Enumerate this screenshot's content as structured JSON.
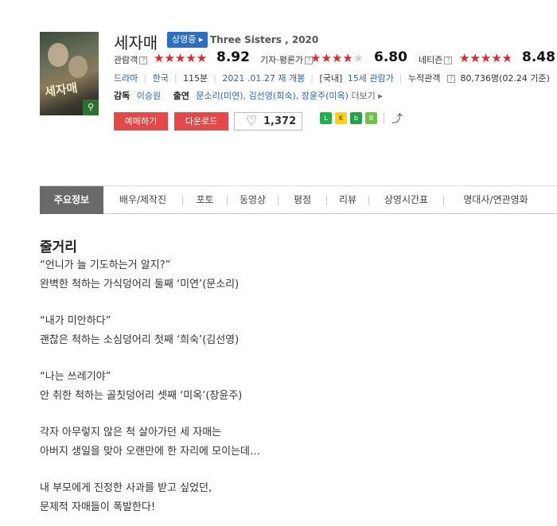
{
  "movie": {
    "title": "세자매",
    "status_badge": "상영중 ▸",
    "english_title": "Three Sisters , 2020"
  },
  "ratings": [
    {
      "label": "관람객",
      "help": "?",
      "score": "8.92",
      "value": 8.92
    },
    {
      "label": "기자·평론가",
      "help": "?",
      "score": "6.80",
      "value": 6.8
    },
    {
      "label": "네티즌",
      "help": "?",
      "score": "8.48",
      "value": 8.48
    }
  ],
  "meta": {
    "genre": "드라마",
    "country": "한국",
    "runtime": "115분",
    "release": "2021 .01.27 재 개봉",
    "rating_prefix": "[국내]",
    "rating": "15세 관람가",
    "audience_label": "누적관객",
    "audience_help": "?",
    "audience": "80,736명(02.24 기준)"
  },
  "crew": {
    "director_label": "감독",
    "director": "이승원",
    "cast_label": "출연",
    "cast": [
      "문소리(미연)",
      "김선영(희숙)",
      "장윤주(미옥)"
    ],
    "more": "더보기 ▸"
  },
  "actions": {
    "reserve": "예매하기",
    "download": "다운로드",
    "like_count": "1,372"
  },
  "share": {
    "icons": [
      "line-icon",
      "kakaotalk-icon",
      "band-icon",
      "naver-blog-icon"
    ],
    "share_icon": "share-icon"
  },
  "tabs": [
    "주요정보",
    "배우/제작진",
    "포토",
    "동영상",
    "평점",
    "리뷰",
    "상영시간표",
    "명대사/연관영화"
  ],
  "synopsis": {
    "heading": "줄거리",
    "lines": [
      "“언니가 늘 기도하는거 알지?”",
      " 완벽한 척하는 가식덩어리 둘째 ‘미연’(문소리)",
      "",
      " “내가 미안하다”",
      " 괜찮은 척하는 소심덩어리 첫째 ‘희숙’(김선영)",
      "",
      " “나는 쓰레기야”",
      " 안 취한 척하는 골칫덩어리 셋째 ‘미옥’(장윤주)",
      "",
      " 각자 아무렇지 않은 척 살아가던 세 자매는",
      " 아버지 생일을 맞아 오랜만에 한 자리에 모이는데…",
      "",
      " 내 부모에게 진정한 사과를 받고 싶었던,",
      " 문제적 자매들이 폭발한다!"
    ]
  },
  "colors": {
    "accent_red": "#e44848",
    "badge_blue": "#2b6ec2",
    "link_blue": "#2f63b8",
    "tab_active_bg": "#6a6a6a"
  }
}
